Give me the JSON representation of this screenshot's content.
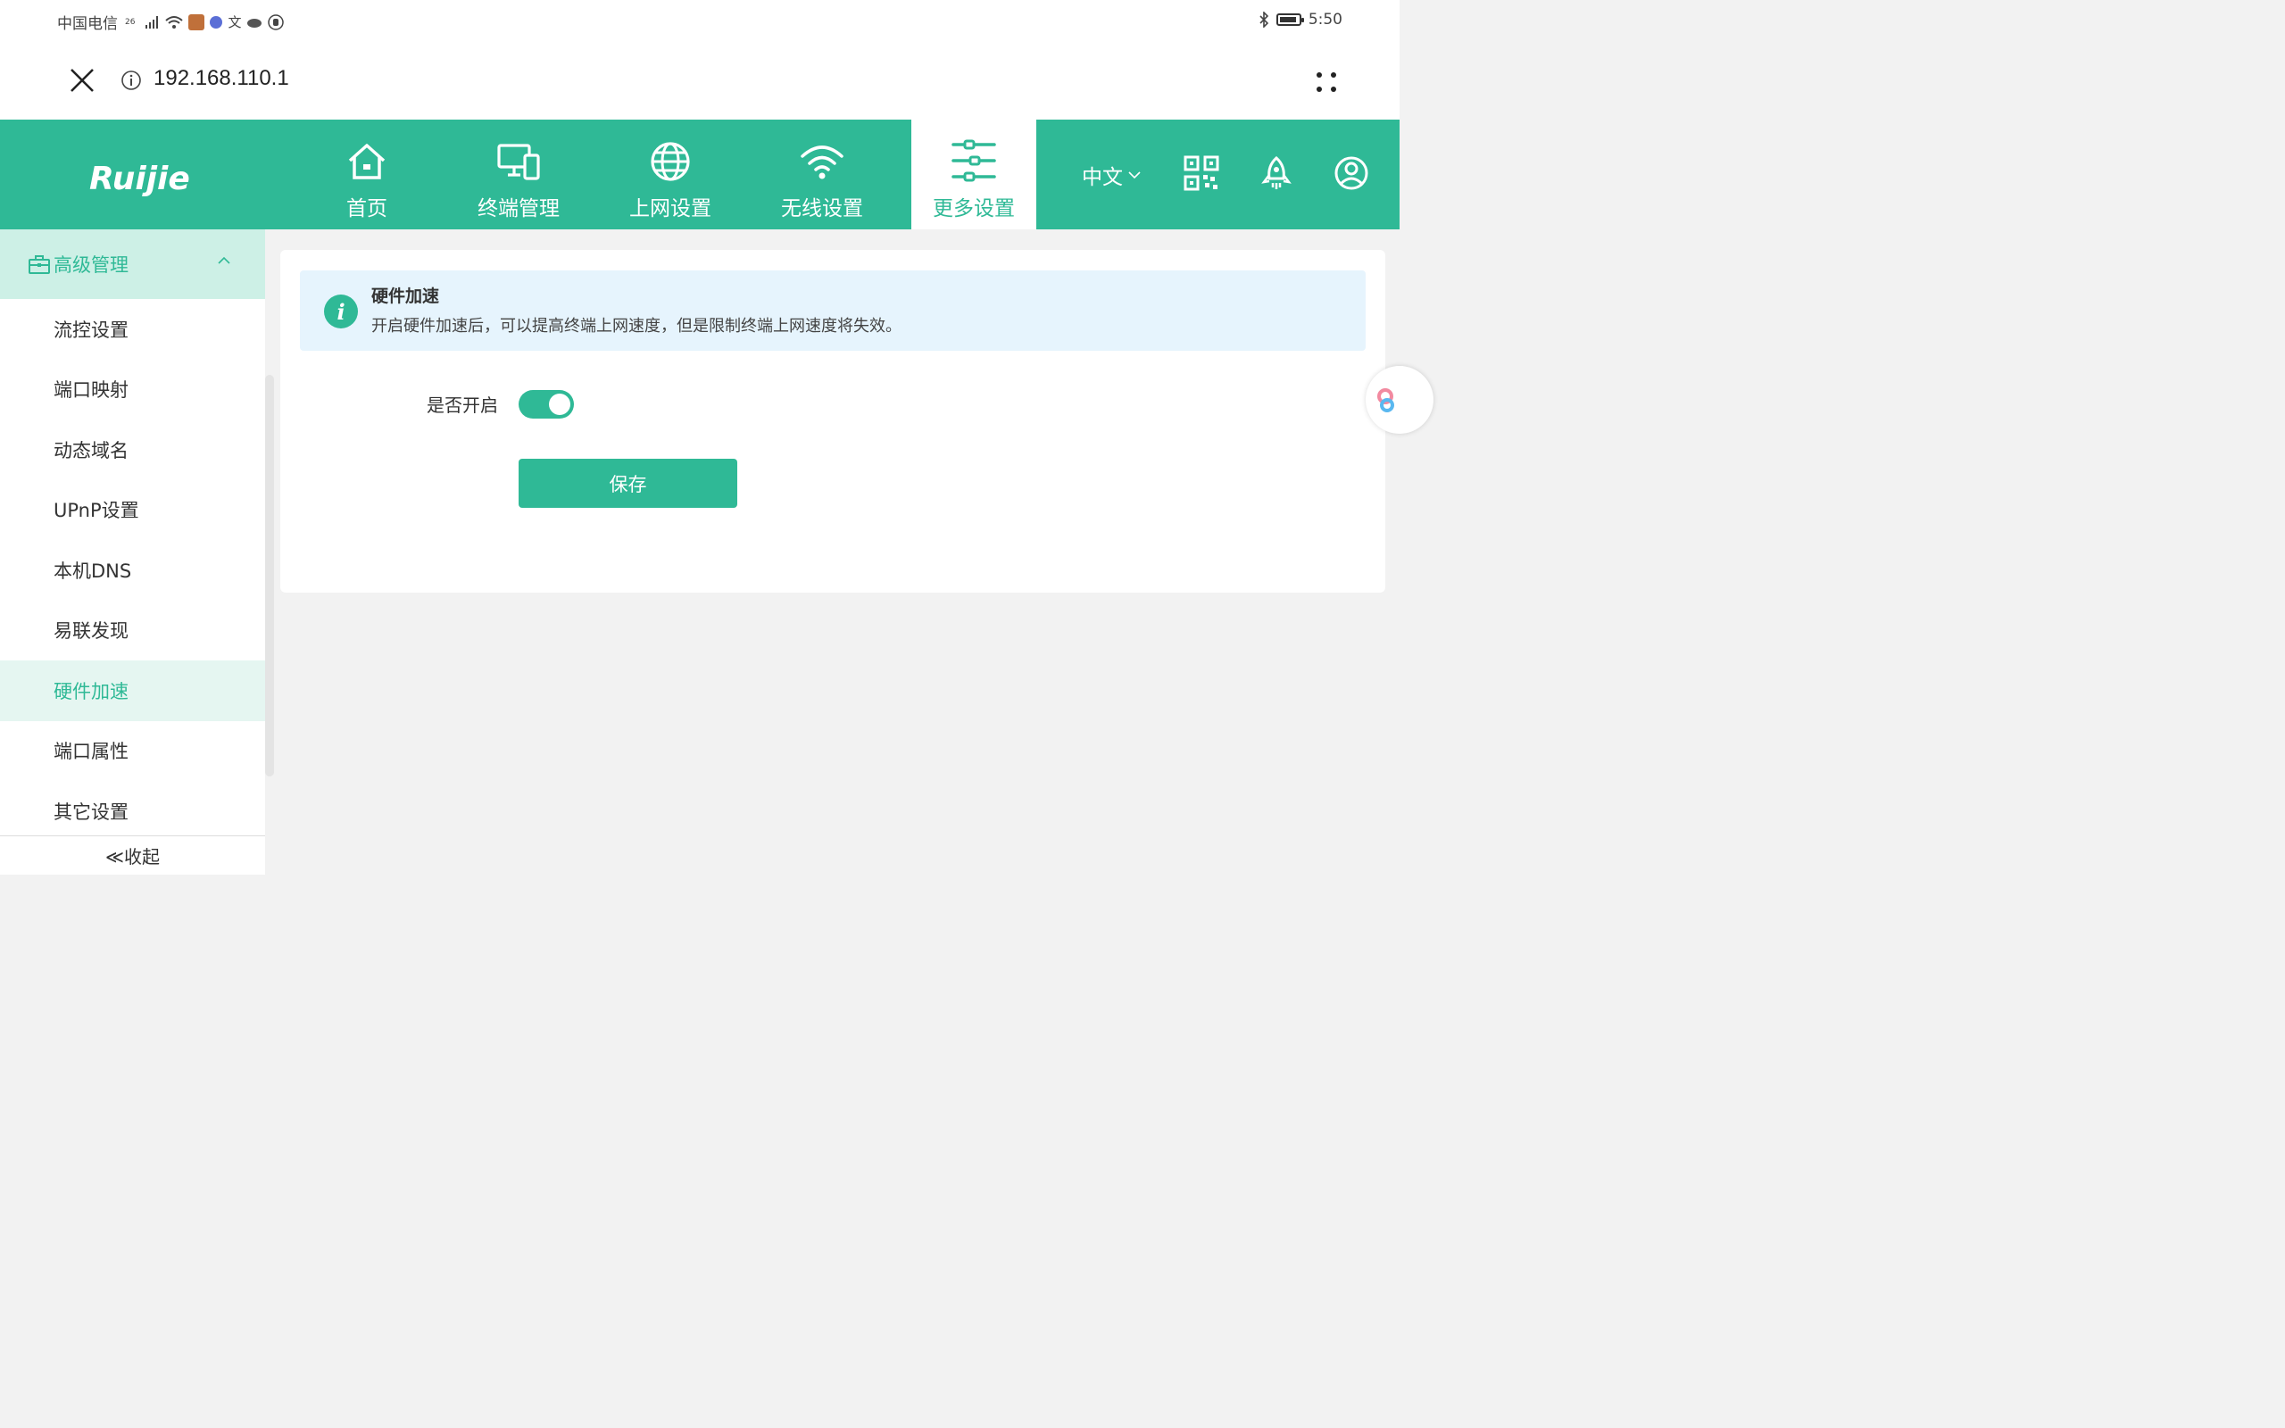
{
  "status_bar": {
    "carrier": "中国电信",
    "network": "26",
    "time": "5:50"
  },
  "browser": {
    "url": "192.168.110.1"
  },
  "brand": {
    "logo_text": "Ruijie",
    "accent_color": "#2fb996"
  },
  "nav": {
    "items": [
      {
        "label": "首页",
        "icon": "home-icon"
      },
      {
        "label": "终端管理",
        "icon": "devices-icon"
      },
      {
        "label": "上网设置",
        "icon": "globe-icon"
      },
      {
        "label": "无线设置",
        "icon": "wifi-icon"
      },
      {
        "label": "更多设置",
        "icon": "sliders-icon",
        "active": true
      }
    ],
    "language": "中文"
  },
  "sidebar": {
    "group_title": "高级管理",
    "items": [
      {
        "label": "流控设置"
      },
      {
        "label": "端口映射"
      },
      {
        "label": "动态域名"
      },
      {
        "label": "UPnP设置"
      },
      {
        "label": "本机DNS"
      },
      {
        "label": "易联发现"
      },
      {
        "label": "硬件加速",
        "active": true
      },
      {
        "label": "端口属性"
      },
      {
        "label": "其它设置"
      }
    ],
    "collapse_label": "≪收起"
  },
  "main": {
    "alert_title": "硬件加速",
    "alert_desc": "开启硬件加速后，可以提高终端上网速度，但是限制终端上网速度将失效。",
    "enable_label": "是否开启",
    "enabled": true,
    "save_label": "保存"
  }
}
